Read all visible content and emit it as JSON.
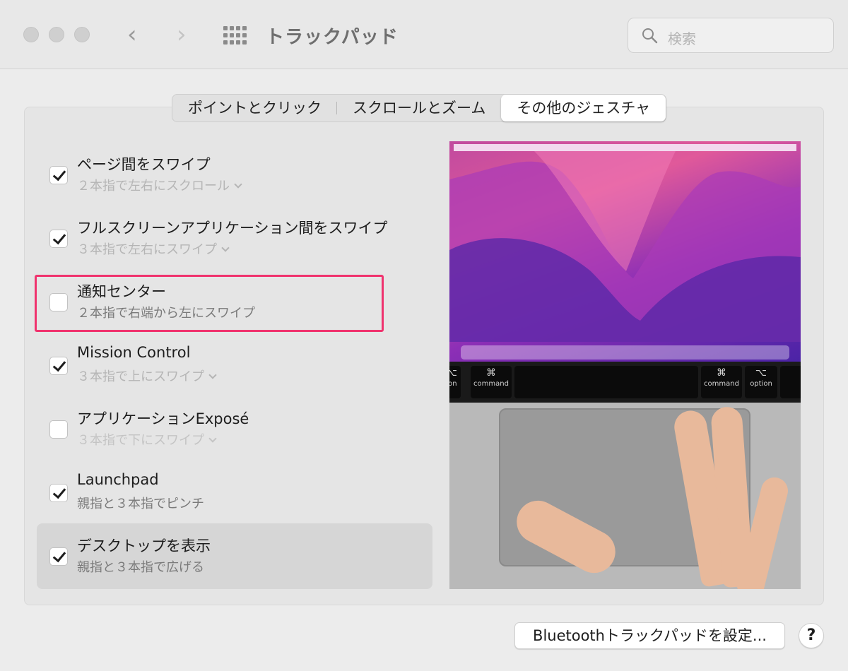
{
  "window": {
    "title": "トラックパッド",
    "back_icon": "chevron-left-icon",
    "forward_icon": "chevron-right-icon",
    "grid_icon": "show-all-grid-icon"
  },
  "search": {
    "placeholder": "検索",
    "icon": "magnifier-icon"
  },
  "tabs": [
    {
      "label": "ポイントとクリック",
      "active": false
    },
    {
      "label": "スクロールとズーム",
      "active": false
    },
    {
      "label": "その他のジェスチャ",
      "active": true
    }
  ],
  "gestures": [
    {
      "label": "ページ間をスワイプ",
      "detail": "２本指で左右にスクロール",
      "checked": true,
      "has_menu": true
    },
    {
      "label": "フルスクリーンアプリケーション間をスワイプ",
      "detail": "３本指で左右にスワイプ",
      "checked": true,
      "has_menu": true
    },
    {
      "label": "通知センター",
      "detail": "２本指で右端から左にスワイプ",
      "checked": false,
      "has_menu": false,
      "highlighted": true,
      "highlight_color": "#f0336e"
    },
    {
      "label": "Mission Control",
      "detail": "３本指で上にスワイプ",
      "checked": true,
      "has_menu": true
    },
    {
      "label": "アプリケーションExposé",
      "detail": "３本指で下にスワイプ",
      "checked": false,
      "has_menu": true
    },
    {
      "label": "Launchpad",
      "detail": "親指と３本指でピンチ",
      "checked": true,
      "has_menu": false
    },
    {
      "label": "デスクトップを表示",
      "detail": "親指と３本指で広げる",
      "checked": true,
      "has_menu": false,
      "selected": true
    }
  ],
  "preview": {
    "keys": [
      {
        "symbol": "⌥",
        "label": "ion"
      },
      {
        "symbol": "⌘",
        "label": "command"
      },
      {
        "symbol": "⌘",
        "label": "command"
      },
      {
        "symbol": "⌥",
        "label": "option"
      }
    ]
  },
  "footer": {
    "bluetooth_button": "Bluetoothトラックパッドを設定...",
    "help_button": "?"
  }
}
